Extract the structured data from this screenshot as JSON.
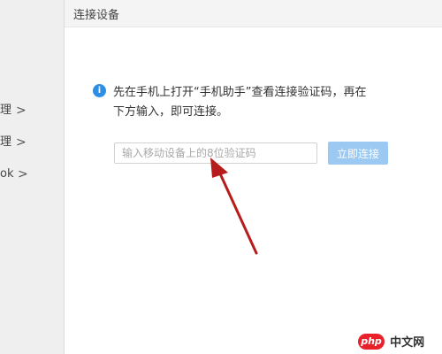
{
  "sidebar": {
    "items": [
      {
        "label": "理",
        "chevron": ">"
      },
      {
        "label": "理",
        "chevron": ">"
      },
      {
        "label": "ok",
        "chevron": ">"
      }
    ]
  },
  "panel": {
    "title": "连接设备",
    "info_icon": "i",
    "instruction_line1": "先在手机上打开“手机助手”查看连接验证码，再在",
    "instruction_line2": "下方输入，即可连接。",
    "input_placeholder": "输入移动设备上的8位验证码",
    "input_value": "",
    "connect_label": "立即连接"
  },
  "watermark": {
    "logo": "php",
    "text": "中文网"
  },
  "colors": {
    "accent": "#2d8ee6",
    "button": "#9cc9f2",
    "arrow": "#b71c1c",
    "watermark_red": "#e8212a"
  },
  "icons": {
    "info": "info-icon",
    "chevron": "chevron-right-icon",
    "annotation": "red-arrow-icon"
  }
}
